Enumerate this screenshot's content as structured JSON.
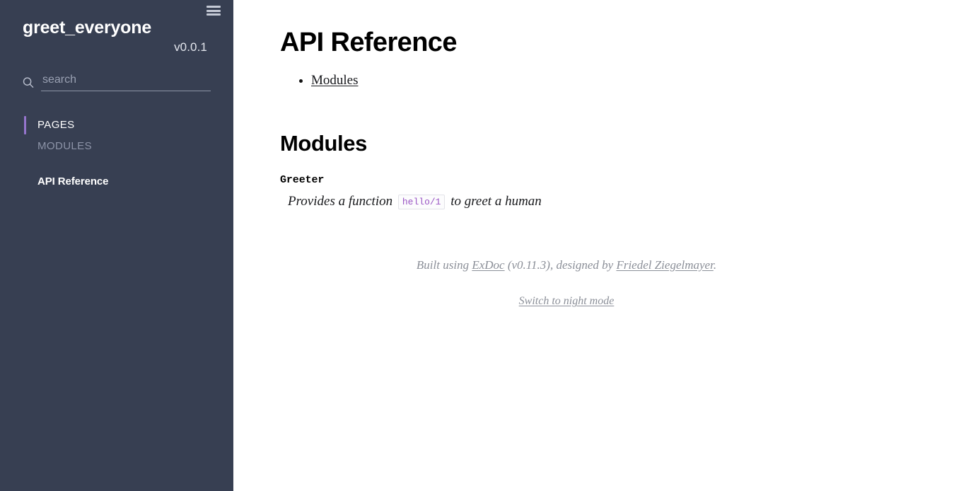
{
  "sidebar": {
    "toggle_icon": "hamburger-icon",
    "project_name": "greet_everyone",
    "project_version": "v0.0.1",
    "search": {
      "icon": "search-icon",
      "placeholder": "search",
      "value": ""
    },
    "tabs": [
      {
        "label": "PAGES",
        "active": true
      },
      {
        "label": "MODULES",
        "active": false
      }
    ],
    "items": [
      {
        "label": "API Reference"
      }
    ],
    "colors": {
      "background": "#373f52",
      "accent": "#9575cd",
      "text": "#ffffff",
      "muted_text": "#8d94a8"
    }
  },
  "main": {
    "title": "API Reference",
    "toc": [
      {
        "label": "Modules"
      }
    ],
    "section": {
      "title": "Modules",
      "modules": [
        {
          "name": "Greeter",
          "summary_before": "Provides a function",
          "summary_code": "hello/1",
          "summary_after": "to greet a human"
        }
      ]
    },
    "footer": {
      "built_prefix": "Built using ",
      "exdoc_link": "ExDoc",
      "version_text": " (v0.11.3), designed by ",
      "author_link": "Friedel Ziegelmayer",
      "suffix": ".",
      "night_mode_label": "Switch to night mode"
    }
  }
}
